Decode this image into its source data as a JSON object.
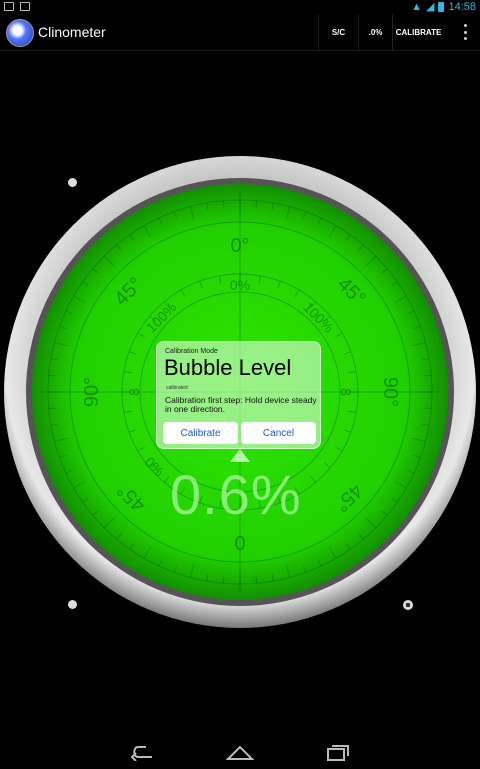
{
  "status_bar": {
    "time": "14:58",
    "icons": [
      "gallery-icon",
      "game-icon",
      "wifi-icon",
      "signal-icon",
      "battery-icon"
    ]
  },
  "action_bar": {
    "title": "Clinometer",
    "buttons": {
      "sc": "S/C",
      "percent": ".0%",
      "calibrate": "CALIBRATE"
    }
  },
  "dial": {
    "outer_labels": [
      "0°",
      "45°",
      "90°",
      "45°",
      "0",
      "45°",
      "90°",
      "45°"
    ],
    "inner_labels": [
      "0%",
      "100%",
      "8",
      "8",
      "%0",
      "100%"
    ],
    "accent": "#22dd00"
  },
  "dialog": {
    "mode": "Calibration Mode",
    "title": "Bubble  Level",
    "status": "calibrated",
    "message": "Calibration first step: Hold device steady in one direction.",
    "calibrate_label": "Calibrate",
    "cancel_label": "Cancel"
  },
  "reading": "0.6%",
  "nav": {
    "icons": [
      "back-icon",
      "home-icon",
      "recents-icon"
    ]
  }
}
